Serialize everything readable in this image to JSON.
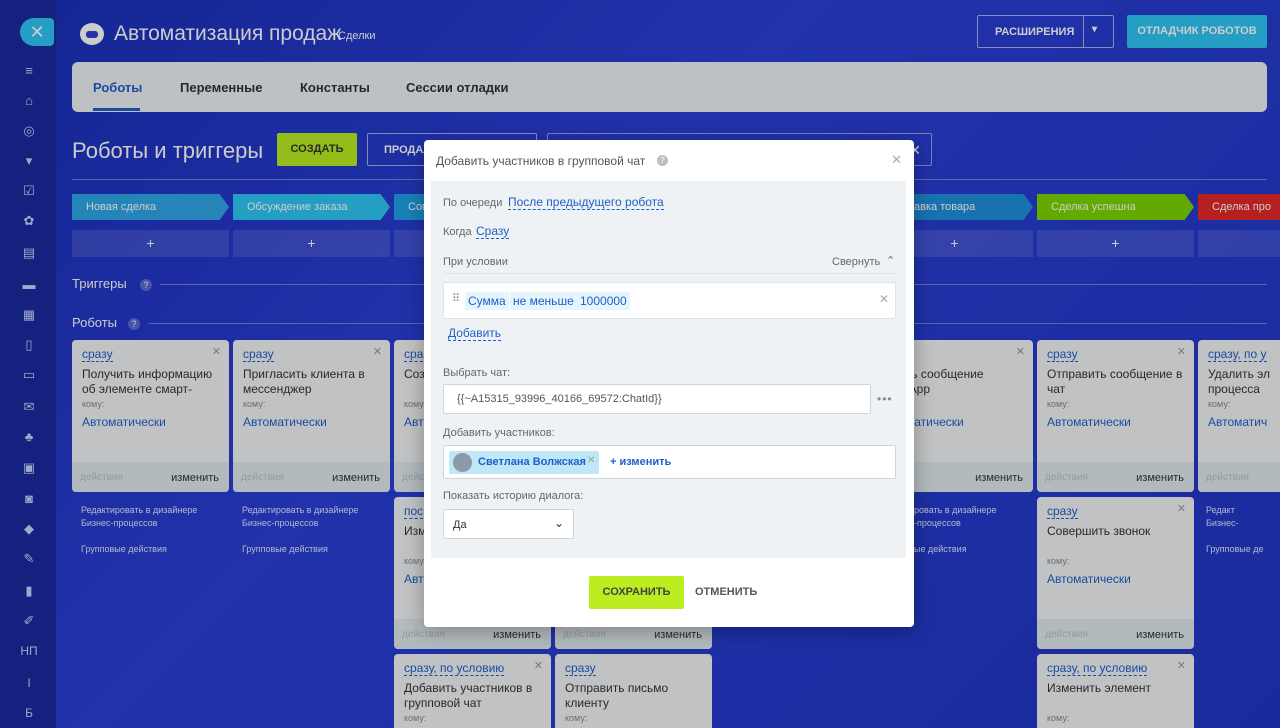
{
  "sidebar": {
    "close": "✕",
    "initials_np": "НП",
    "initials_i": "І",
    "initials_b": "Б"
  },
  "header": {
    "title": "Автоматизация продаж",
    "subtitle": "Сделки",
    "extensions_label": "РАСШИРЕНИЯ",
    "debug_label": "ОТЛАДЧИК РОБОТОВ"
  },
  "tabs": [
    "Роботы",
    "Переменные",
    "Константы",
    "Сессии отладки"
  ],
  "toolbar": {
    "section_title": "Роботы и триггеры",
    "create_label": "СОЗДАТЬ",
    "pipeline_label": "ПРОДАЖ"
  },
  "stages": [
    {
      "label": "Новая сделка",
      "color": "#2fa7e6"
    },
    {
      "label": "Обсуждение заказа",
      "color": "#2fc6f6"
    },
    {
      "label": "Сог",
      "color": "#1fa1e8"
    },
    {
      "label": "авка товара",
      "color": "#1e8fdd"
    },
    {
      "label": "Сделка успешна",
      "color": "#7bd500"
    },
    {
      "label": "Сделка про",
      "color": "#e52828"
    }
  ],
  "rows": {
    "triggers": "Триггеры",
    "robots": "Роботы"
  },
  "cards": [
    {
      "cond": "сразу",
      "name": "Получить информацию об элементе смарт-",
      "komu": "кому:",
      "resp": "Автоматически",
      "actions": "действия",
      "edit": "изменить"
    },
    {
      "cond": "сразу",
      "name": "Пригласить клиента в мессенджер",
      "komu": "кому:",
      "resp": "Автоматически",
      "actions": "действия",
      "edit": "изменить"
    },
    {
      "cond": "сра",
      "name": "Соз",
      "komu": "кому",
      "resp": "Авт",
      "actions": "действия",
      "edit": "изменить"
    },
    {
      "cond": "сразу",
      "name": "авить сообщение hatsApp",
      "komu": "",
      "resp": "матически",
      "actions": "ия",
      "edit": "изменить"
    },
    {
      "cond": "сразу",
      "name": "Отправить сообщение в чат",
      "komu": "кому:",
      "resp": "Автоматически",
      "actions": "действия",
      "edit": "изменить"
    },
    {
      "cond": "сразу, по у",
      "name": "Удалить эл процесса",
      "komu": "кому:",
      "resp": "Автоматич",
      "actions": "действия",
      "edit": ""
    },
    {
      "cond": "пос",
      "name": "Изм",
      "komu": "кому",
      "resp": "Авто",
      "actions": "действия",
      "edit": "изменить"
    },
    {
      "cond": "",
      "name": "",
      "komu": "",
      "resp": "",
      "actions": "действия",
      "edit": "изменить"
    },
    {
      "cond": "сразу",
      "name": "Совершить звонок",
      "komu": "кому:",
      "resp": "Автоматически",
      "actions": "действия",
      "edit": "изменить"
    },
    {
      "cond": "сразу, по условию",
      "name": "Добавить участников в групповой чат",
      "komu": "кому:"
    },
    {
      "cond": "сразу",
      "name": "Отправить письмо клиенту",
      "komu": "кому:"
    },
    {
      "cond": "сразу, по условию",
      "name": "Изменить элемент",
      "komu": "кому:"
    }
  ],
  "below_links": {
    "designer": "Редактировать в дизайнере Бизнес-процессов",
    "designer_short": "Редактировать в дизайнере Бизнес-процессов",
    "group": "Групповые действия",
    "designer_cut": "ровать в дизайнере -процессов",
    "group_cut": "ые действия",
    "designer_edge": "Редакт Бизнес-",
    "group_edge": "Групповые де"
  },
  "modal": {
    "title": "Добавить участников в групповой чат",
    "order_label": "По очереди",
    "order_value": "После предыдущего робота",
    "when_label": "Когда",
    "when_value": "Сразу",
    "condition_label": "При условии",
    "collapse_label": "Свернуть",
    "condition": {
      "field": "Сумма",
      "operator": "не меньше",
      "value": "1000000"
    },
    "add_label": "Добавить",
    "chat_label": "Выбрать чат:",
    "chat_value": "{{~A15315_93996_40166_69572:ChatId}}",
    "members_label": "Добавить участников:",
    "member_name": "Светлана Волжская",
    "change_label": "+ изменить",
    "history_label": "Показать историю диалога:",
    "history_value": "Да",
    "save_label": "СОХРАНИТЬ",
    "cancel_label": "ОТМЕНИТЬ"
  }
}
